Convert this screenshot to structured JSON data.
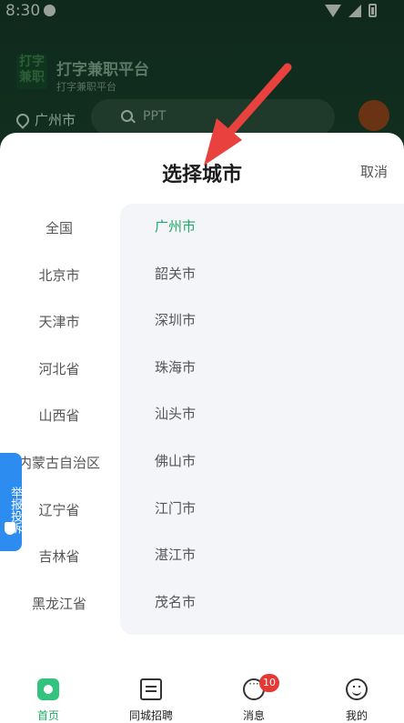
{
  "status_bar": {
    "time": "8:30"
  },
  "background_app": {
    "logo_text": "打字\n兼职",
    "title": "打字兼职平台",
    "subtitle": "打字兼职平台",
    "location": "广州市",
    "search_placeholder": "PPT"
  },
  "city_picker": {
    "title": "选择城市",
    "cancel_label": "取消",
    "provinces": [
      "全国",
      "北京市",
      "天津市",
      "河北省",
      "山西省",
      "内蒙古自治区",
      "辽宁省",
      "吉林省",
      "黑龙江省"
    ],
    "cities": [
      "广州市",
      "韶关市",
      "深圳市",
      "珠海市",
      "汕头市",
      "佛山市",
      "江门市",
      "湛江市",
      "茂名市"
    ],
    "selected_city": "广州市"
  },
  "report_button": {
    "label": "举报投诉"
  },
  "tabbar": {
    "tabs": [
      {
        "label": "首页",
        "icon": "home-icon",
        "active": true
      },
      {
        "label": "同城招聘",
        "icon": "job-list-icon",
        "active": false
      },
      {
        "label": "消息",
        "icon": "message-icon",
        "active": false,
        "badge": "10"
      },
      {
        "label": "我的",
        "icon": "profile-icon",
        "active": false
      }
    ]
  },
  "colors": {
    "accent": "#20a86a",
    "badge": "#e53935",
    "report_button": "#2d8cf0",
    "annotation_arrow": "#e8413e"
  }
}
